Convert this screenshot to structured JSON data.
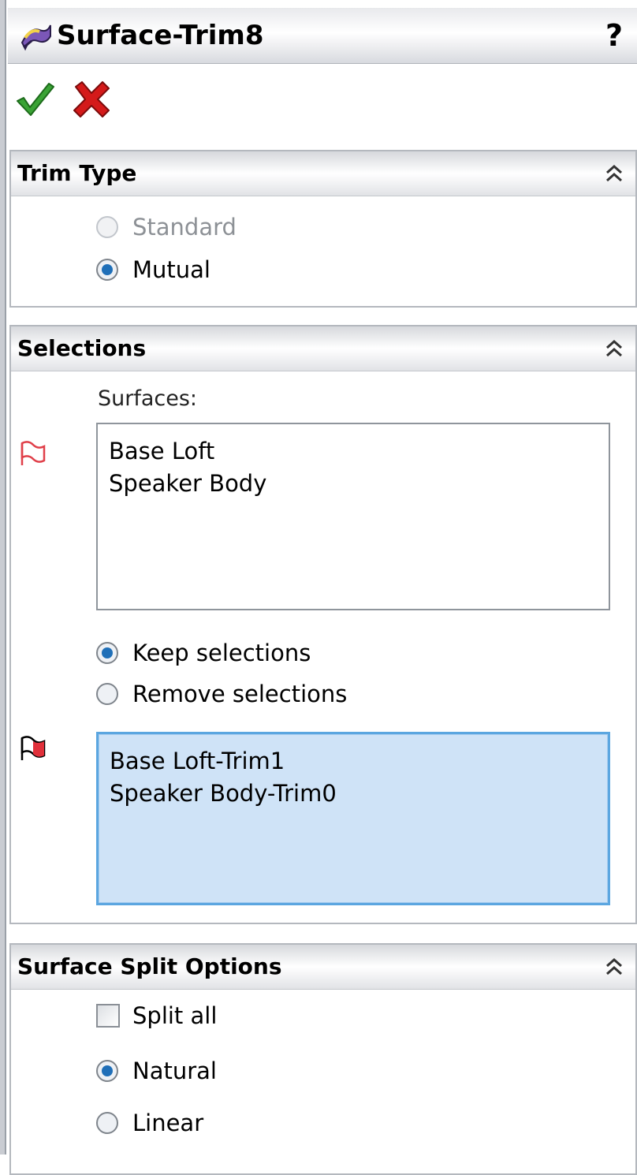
{
  "window": {
    "title": "Surface-Trim8",
    "help_glyph": "?"
  },
  "icons": {
    "feature": "surface-trim-icon",
    "ok": "check-icon",
    "cancel": "x-icon",
    "collapse": "double-chevron-up-icon",
    "surfaces_selector": "surface-selection-icon",
    "pieces_selector": "pieces-selection-icon"
  },
  "colors": {
    "ok_green": "#3aa335",
    "cancel_red": "#d41a1a",
    "active_list_bg": "#cfe3f7",
    "active_list_border": "#5ba6e0",
    "disabled_text": "#8d9196"
  },
  "groups": {
    "trim_type": {
      "title": "Trim Type",
      "options": [
        {
          "label": "Standard",
          "selected": false,
          "enabled": false
        },
        {
          "label": "Mutual",
          "selected": true,
          "enabled": true
        }
      ]
    },
    "selections": {
      "title": "Selections",
      "surfaces_label": "Surfaces:",
      "surfaces": [
        "Base Loft",
        "Speaker Body"
      ],
      "keep_options": [
        {
          "label": "Keep selections",
          "selected": true
        },
        {
          "label": "Remove selections",
          "selected": false
        }
      ],
      "pieces": [
        "Base Loft-Trim1",
        "Speaker Body-Trim0"
      ]
    },
    "split_options": {
      "title": "Surface Split Options",
      "split_all": {
        "label": "Split all",
        "checked": false
      },
      "options": [
        {
          "label": "Natural",
          "selected": true
        },
        {
          "label": "Linear",
          "selected": false
        }
      ]
    }
  }
}
